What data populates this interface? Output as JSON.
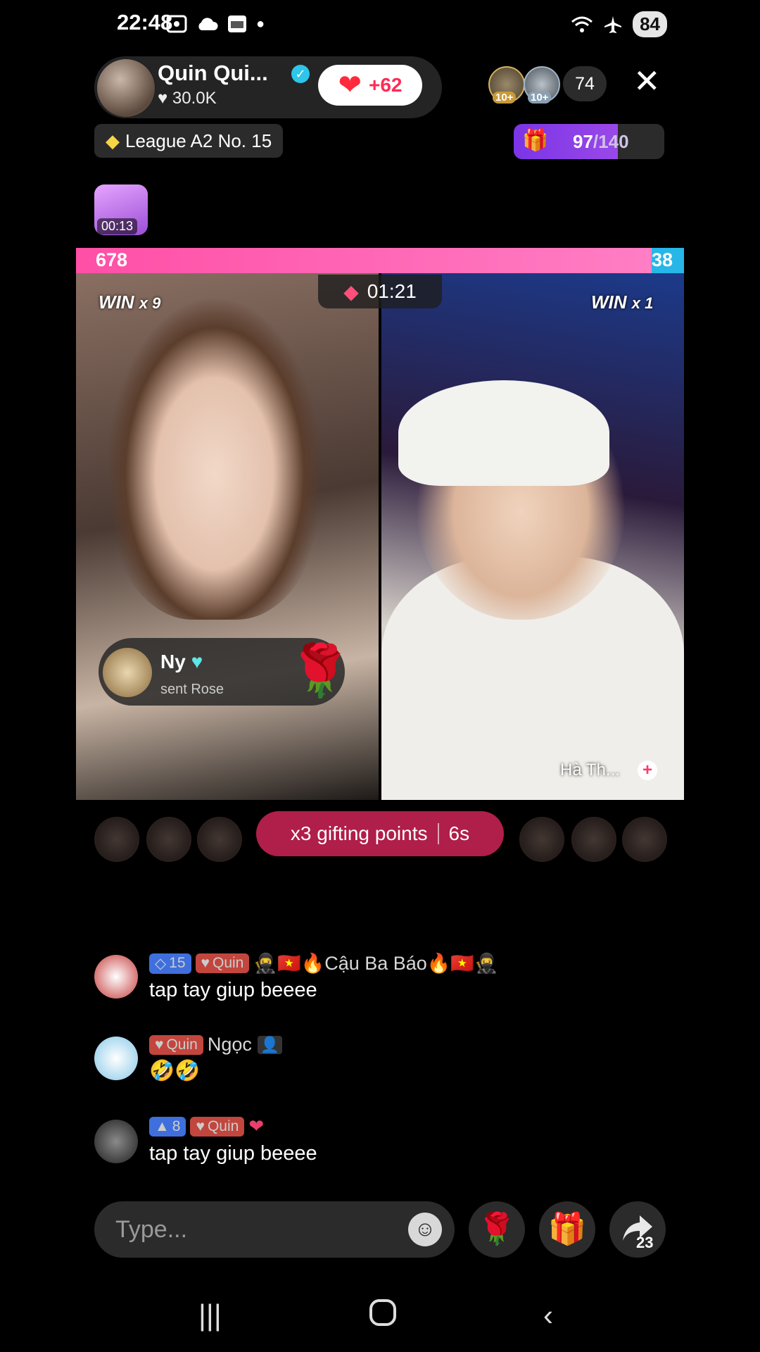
{
  "status": {
    "time": "22:48",
    "battery": "84"
  },
  "host": {
    "name": "Quin Qui...",
    "likes": "30.0K",
    "like_gain": "+62"
  },
  "viewers": {
    "badge_1": "10+",
    "badge_2": "10+",
    "count": "74"
  },
  "league": {
    "label": "League A2 No. 15"
  },
  "goal": {
    "current": "97",
    "max": "/140",
    "progress": 0.69
  },
  "treasure": {
    "timer": "00:13"
  },
  "battle": {
    "score_left": "678",
    "score_right": "38",
    "timer": "01:21",
    "win_left": "WIN",
    "win_left_mult": "x 9",
    "win_right": "WIN",
    "win_right_mult": "x 1",
    "left_share": 0.947,
    "right_host_name": "Hà Th..."
  },
  "gift_toast": {
    "sender": "Ny",
    "action": "sent Rose"
  },
  "boost": {
    "label": "x3 gifting points",
    "timer": "6s"
  },
  "comments": [
    {
      "level": "15",
      "fan_badge": "Quin",
      "name": "🥷🇻🇳🔥Cậu Ba Báo🔥🇻🇳🥷",
      "text": "tap tay giup beeee"
    },
    {
      "fan_badge": "Quin",
      "name": "Ngọc",
      "text": "🤣🤣"
    },
    {
      "level": "8",
      "fan_badge": "Quin",
      "name": "",
      "text": "tap tay giup beeee"
    }
  ],
  "input": {
    "placeholder": "Type..."
  },
  "share": {
    "count": "23"
  },
  "icons": {
    "heart": "heart-icon",
    "close": "close-icon",
    "gem": "gem-icon",
    "rose": "rose-icon",
    "gift": "gift-icon",
    "share": "share-icon",
    "emoji": "emoji-icon"
  },
  "colors": {
    "battle_left": "#ff4fa6",
    "battle_right": "#27b6e8",
    "boost_pill": "#b01e4a",
    "goal_fill": "#7a35e6"
  }
}
